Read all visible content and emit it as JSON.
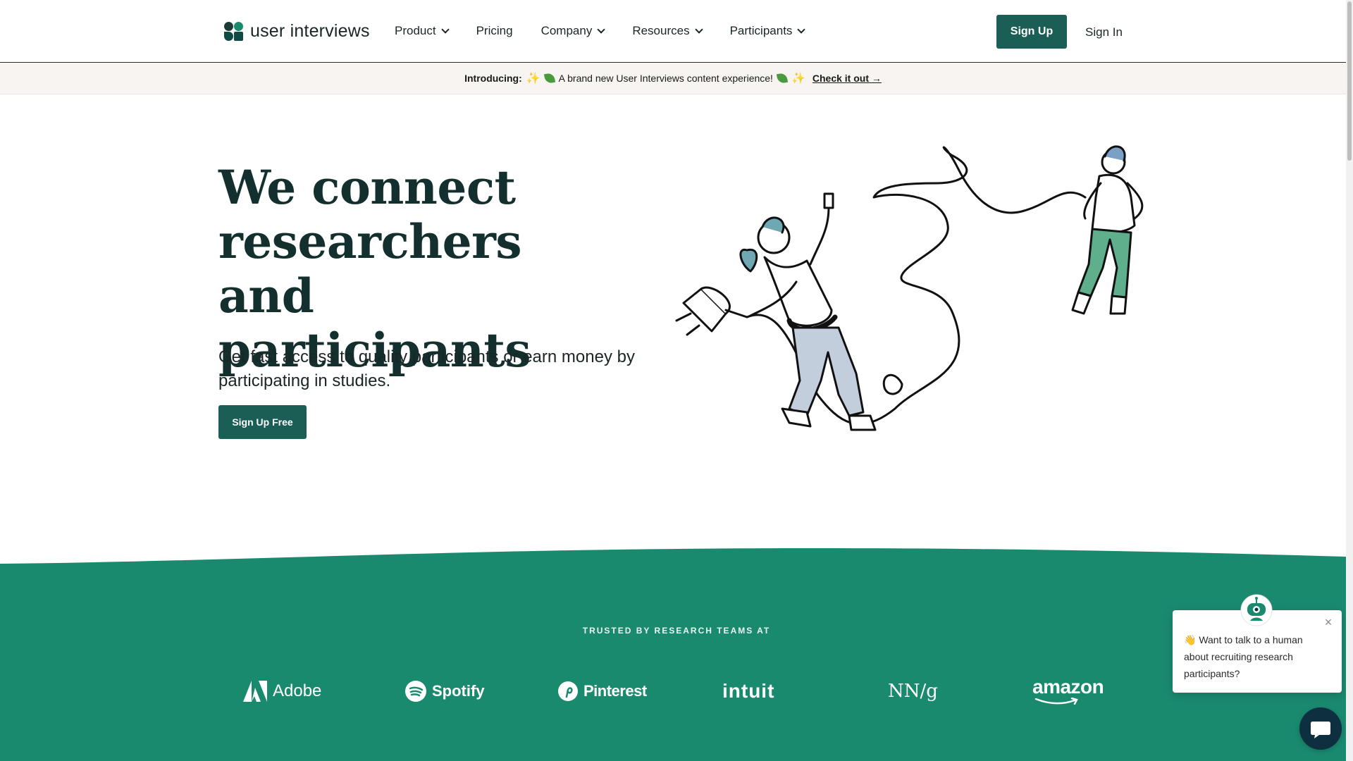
{
  "header": {
    "logo_text": "user interviews",
    "nav": [
      {
        "label": "Product",
        "dropdown": true
      },
      {
        "label": "Pricing",
        "dropdown": false
      },
      {
        "label": "Company",
        "dropdown": true
      },
      {
        "label": "Resources",
        "dropdown": true
      },
      {
        "label": "Participants",
        "dropdown": true
      }
    ],
    "signup_label": "Sign Up",
    "signin_label": "Sign In"
  },
  "banner": {
    "intro": "Introducing:",
    "message": "A brand new User Interviews content experience!",
    "cta": "Check it out →"
  },
  "hero": {
    "title": "We connect researchers and participants",
    "subtitle": "Get fast access to quality participants or earn money by participating in studies.",
    "cta": "Sign Up Free"
  },
  "trusted": {
    "label": "TRUSTED BY RESEARCH TEAMS AT",
    "brands": [
      "Adobe",
      "Spotify",
      "Pinterest",
      "intuit",
      "NN/g",
      "amazon"
    ]
  },
  "chat": {
    "message": "Want to talk to a human about recruiting research participants?",
    "wave_emoji": "👋"
  },
  "colors": {
    "brand_green": "#1b5e55",
    "band_green": "#1a8a6f",
    "title_ink": "#13302f"
  }
}
